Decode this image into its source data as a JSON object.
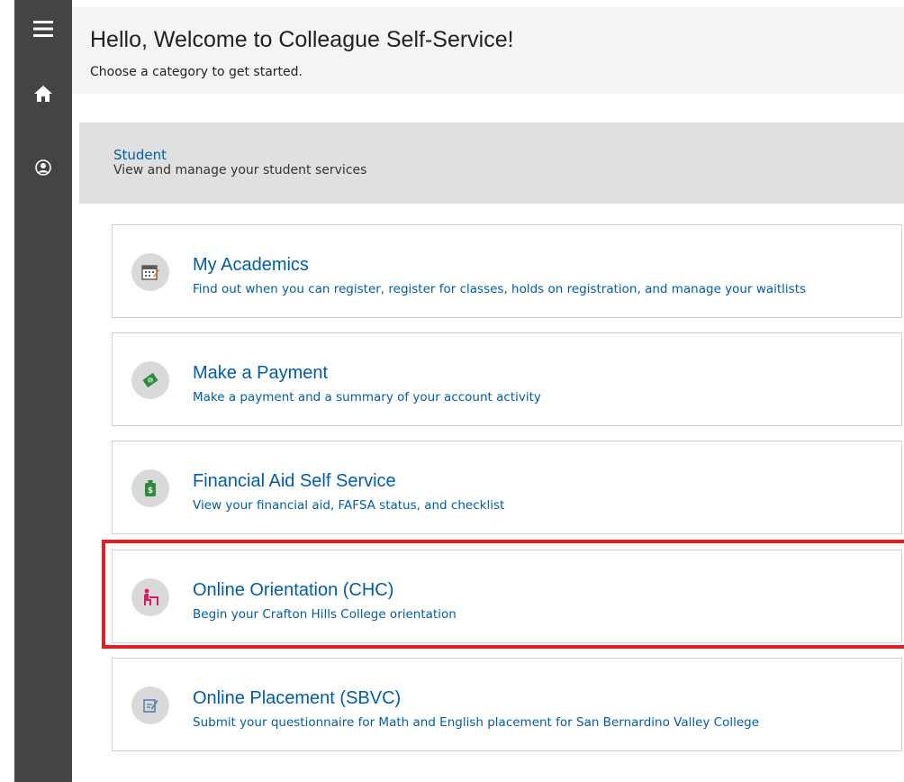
{
  "sidebar": {
    "items": [
      {
        "icon": "hamburger-menu-icon"
      },
      {
        "icon": "home-icon"
      },
      {
        "icon": "user-profile-icon"
      }
    ]
  },
  "header": {
    "title": "Hello, Welcome to Colleague Self-Service!",
    "subtitle": "Choose a category to get started."
  },
  "category": {
    "title": "Student",
    "description": "View and manage your student services"
  },
  "tiles": [
    {
      "title": "My Academics",
      "description": "Find out when you can register, register for classes, holds on registration, and manage your waitlists",
      "icon": "calendar-icon"
    },
    {
      "title": "Make a Payment",
      "description": "Make a payment and a summary of your account activity",
      "icon": "money-icon"
    },
    {
      "title": "Financial Aid Self Service",
      "description": "View your financial aid, FAFSA status, and checklist",
      "icon": "money-bag-icon"
    },
    {
      "title": "Online Orientation (CHC)",
      "description": "Begin your Crafton Hills College orientation",
      "icon": "student-desk-icon"
    },
    {
      "title": "Online Placement (SBVC)",
      "description": "Submit your questionnaire for Math and English placement for San Bernardino Valley College",
      "icon": "questionnaire-icon"
    }
  ],
  "colors": {
    "sidebar": "#444444",
    "link": "#005ea3",
    "highlight": "#e02020"
  }
}
